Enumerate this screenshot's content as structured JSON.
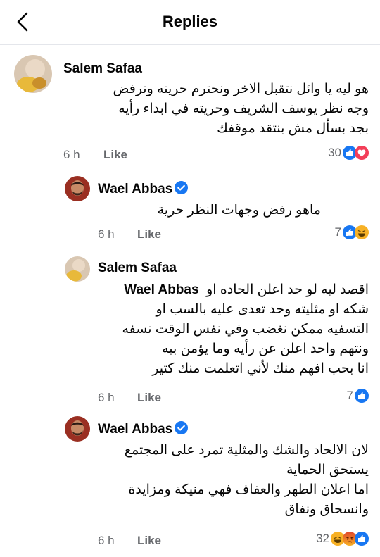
{
  "header": {
    "title": "Replies"
  },
  "comments": [
    {
      "author": "Salem Safaa",
      "lines": [
        "هو ليه يا وائل نتقبل الاخر ونحترم حريته ونرفض",
        "وجه نظر يوسف الشريف وحريته في ابداء رأيه",
        "بجد بسأل مش بنتقد موقفك"
      ],
      "time": "6 h",
      "like": "Like",
      "reactions": {
        "count": "30",
        "icons": [
          "like-reaction",
          "love-reaction"
        ]
      }
    },
    {
      "author": "Wael Abbas",
      "verified": true,
      "lines": [
        "ماهو رفض وجهات النظر حرية"
      ],
      "time": "6 h",
      "like": "Like",
      "reactions": {
        "count": "7",
        "icons": [
          "like-reaction",
          "haha-reaction"
        ]
      }
    },
    {
      "author": "Salem Safaa",
      "mention": "Wael Abbas",
      "first_line_text": "اقصد ليه لو حد اعلن الحاده او",
      "lines": [
        "شكه او مثليته وحد تعدى عليه بالسب او",
        "التسفيه ممكن نغضب وفي نفس الوقت نسفه",
        "ونتهم واحد اعلن عن رأيه وما يؤمن بيه",
        "انا بحب افهم منك لأني اتعلمت منك كتير"
      ],
      "time": "6 h",
      "like": "Like",
      "reactions": {
        "count": "7",
        "icons": [
          "like-reaction"
        ]
      }
    },
    {
      "author": "Wael Abbas",
      "verified": true,
      "lines": [
        "لان الالحاد والشك والمثلية تمرد على المجتمع",
        "يستحق الحماية",
        "اما اعلان الطهر والعفاف فهي منيكة ومزايدة",
        "وانسحاق ونفاق"
      ],
      "time": "6 h",
      "like": "Like",
      "reactions": {
        "count": "32",
        "icons": [
          "haha-reaction",
          "angry-reaction",
          "like-reaction"
        ]
      }
    }
  ],
  "colors": {
    "like": "#1877f2",
    "love": "#f33e58",
    "haha": "#f7b125",
    "angry": "#e9710f",
    "secondary": "#65676b"
  }
}
